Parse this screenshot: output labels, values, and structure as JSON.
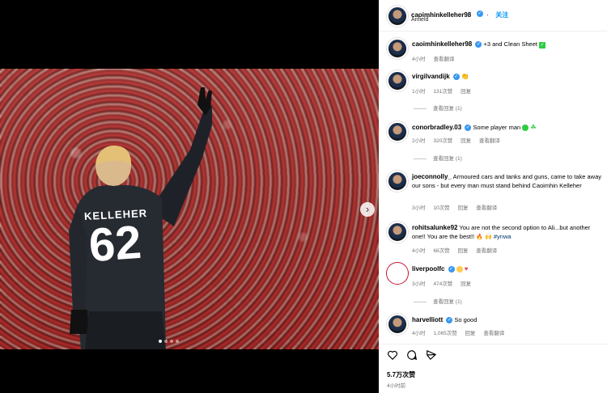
{
  "header": {
    "username": "caoimhinkelleher98",
    "follow": "关注",
    "location": "Anfield"
  },
  "caption": {
    "username": "caoimhinkelleher98",
    "text": "+3 and Clean Sheet",
    "time": "4小时",
    "translate": "查看翻译"
  },
  "comments": [
    {
      "username": "virgilvandijk",
      "text": "",
      "time": "1小时",
      "likes": "131次赞",
      "reply": "回复",
      "view_replies": "查看回复 (1)"
    },
    {
      "username": "conorbradley.03",
      "text": "Some player man",
      "time": "2小时",
      "likes": "320次赞",
      "reply": "回复",
      "translate": "查看翻译",
      "view_replies": "查看回复 (1)"
    },
    {
      "username": "joeconnolly_",
      "text": "Armoured cars and tanks and guns, came to take away our sons - but every man must stand behind Caoimhin Kelleher",
      "time": "3小时",
      "likes": "10次赞",
      "reply": "回复",
      "translate": "查看翻译"
    },
    {
      "username": "rohitsalunke92",
      "text": "You are not the second option to Ali...but another one!! You are the best!!",
      "hashtag": "#ynwa",
      "time": "4小时",
      "likes": "68次赞",
      "reply": "回复",
      "translate": "查看翻译"
    },
    {
      "username": "liverpoolfc",
      "text": "",
      "time": "3小时",
      "likes": "474次赞",
      "reply": "回复",
      "view_replies": "查看回复 (1)"
    },
    {
      "username": "harvelliott",
      "text": "So good",
      "time": "4小时",
      "likes": "1,065次赞",
      "reply": "回复",
      "translate": "查看翻译"
    }
  ],
  "footer": {
    "likes": "5.7万次赞",
    "time": "4小时前"
  },
  "player": {
    "name": "KELLEHER",
    "number": "62"
  },
  "colors": {
    "accent": "#0095f6",
    "verified": "#3897f0",
    "red_heart": "#ed4956"
  }
}
